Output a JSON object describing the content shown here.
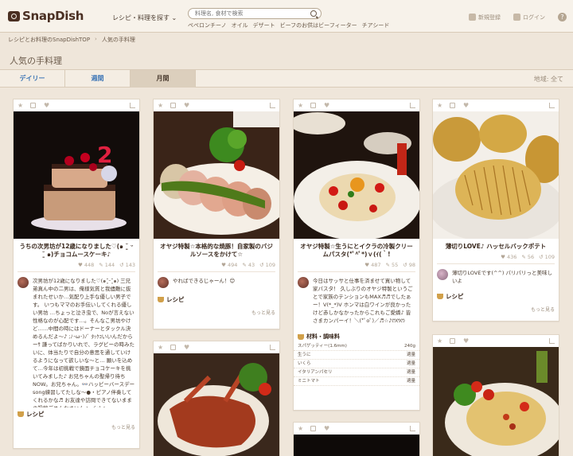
{
  "header": {
    "logo": "SnapDish",
    "category_menu": "レシピ・料理を探す ⌄",
    "search_placeholder": "料理名, 食材で検索",
    "tags": [
      "ペペロンチーノ",
      "オイル",
      "デザート",
      "ビーフのお供はビーフィーター",
      "チアシード"
    ],
    "signup": "新規登録",
    "login": "ログイン",
    "help": "?"
  },
  "breadcrumb": [
    "レシピとお料理のSnapDishTOP",
    "人気の手料理"
  ],
  "page_title": "人気の手料理",
  "tabs": [
    {
      "label": "デイリー"
    },
    {
      "label": "週間"
    },
    {
      "label": "月間"
    }
  ],
  "region": "地域: 全て",
  "cards": [
    {
      "title": "うちの次男坊が12歳になりました♡(๑ ˘͈ ᵕ ˘͈ ๑)チョコムースケーキ♪",
      "likes": "448",
      "comments": "144",
      "resnaps": "143",
      "comment": "次男坊が12歳になりました♡(๑˘͈ᵕ˘͈๑) 三兄弟真ん中の二男は、俺様気質と我儘難に抜まれたせいか…気配り上手な優しい男子です。 いつもママのお手伝いしてくれる優しい男坊 …ちょっと泣き虫で、Noが言えない性格なのが心配です…。そんなこ男坊やけど……中間の時にはドーナーとタックル決めるんだよ〜♪ ;ﾉ･ω･)ﾉﾞ ﾀｯｸｺいいんだからーｻ 謙ってばかりいれで、ラグビーの時みたいに、体当たりで自分の意思を通していけるようになって欲しいな〜と… 願いを込めて…今年は初挑戦で鏡面チョコケーキを挑いてみました♪ お兄ちゃんの聖帰り待ちNOW。お兄ちゃん。👓ハッピーバースデーsong練習してたしな〜●・ピアノ伴奏してくれるかな♬ お友達や訪問できてないままの投稿ごめんなさいん ≻ く:)≺",
      "recipe": "レシピ",
      "more": "もっと見る"
    },
    {
      "title": "オヤジ特製☆本格的な焼豚！自家製のバジルソースをかけて☆",
      "likes": "494",
      "comments": "43",
      "resnaps": "109",
      "comment": "やればできるじゃーん！😊",
      "recipe": "レシピ",
      "more": "もっと見る"
    },
    {
      "title": "オヤジ特製☆生うにとイクラの冷製クリームパスタ(*ﾟ^ﾟ*)ｖ(ｲ(｀!",
      "likes": "487",
      "comments": "55",
      "resnaps": "98",
      "comment": "今日はサッサと仕事を済ませて買い物して家パスタ！ 久しぶりのオヤジ特製というごとで家族のテンションもMAX♬♬でしたぁー！V(*_*)V ホンマは白ワインが良かったけど赤しかなかったからこれもご愛嬌♪ 皆さまカンパーイ！＼(*ﾟoﾟ)／♬☆♪ꯁꯁꯁ",
      "ingredients_title": "材料・調味料",
      "ingredients": [
        {
          "name": "スパゲッティー(1.6mm)",
          "amount": "240g"
        },
        {
          "name": "生うに",
          "amount": "適量"
        },
        {
          "name": "いくら",
          "amount": "適量"
        },
        {
          "name": "イタリアンパセリ",
          "amount": "適量"
        },
        {
          "name": "ミニトマト",
          "amount": "適量"
        }
      ]
    },
    {
      "title": "薄切りLOVE♪ ハッセルバックポテト",
      "likes": "436",
      "comments": "56",
      "resnaps": "109",
      "comment": "薄切りLOVEです(^^) パリパリっと美味しいよ",
      "recipe": "レシピ",
      "more": "もっと見る"
    }
  ],
  "colors": {
    "link_blue": "#3b74b5",
    "brand_brown": "#4a2f22",
    "background": "#efe6da"
  }
}
